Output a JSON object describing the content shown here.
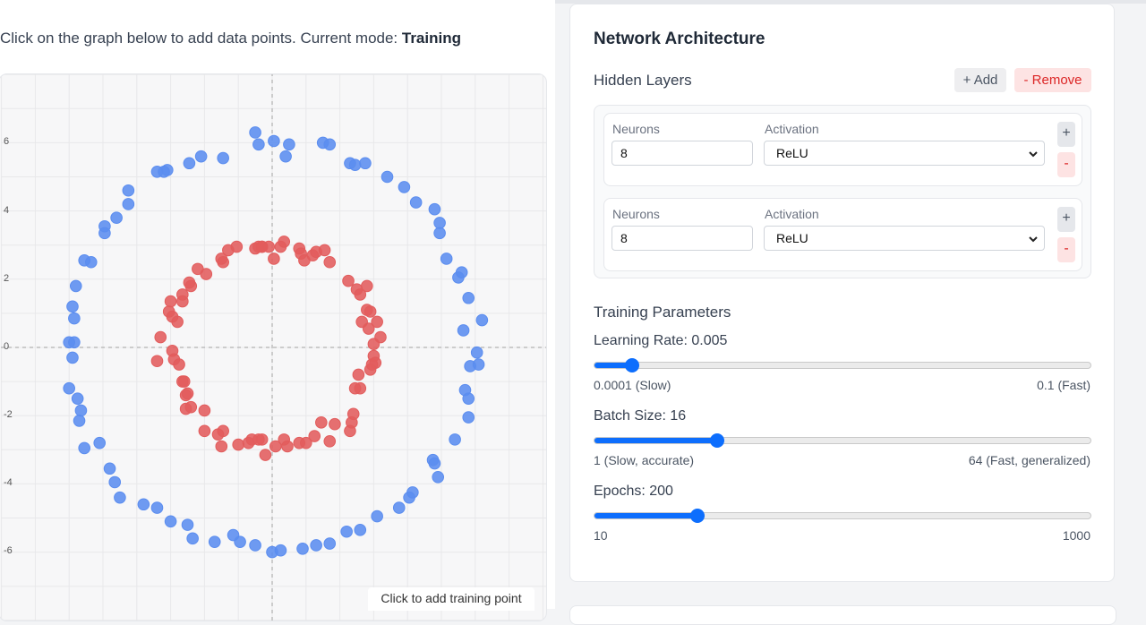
{
  "instruction": {
    "prefix": "Click on the graph below to add data points. Current mode: ",
    "mode": "Training"
  },
  "plot": {
    "hint": "Click to add training point",
    "yticks": [
      "6",
      "4",
      "2",
      "0",
      "-2",
      "-4",
      "-6"
    ],
    "colors": {
      "class_outer": "#5b8def",
      "class_inner": "#e25c5c"
    },
    "blue_points": [
      [
        -0.5,
        6.3
      ],
      [
        -0.4,
        5.95
      ],
      [
        0.05,
        6.05
      ],
      [
        0.5,
        5.95
      ],
      [
        1.5,
        6.0
      ],
      [
        1.7,
        5.95
      ],
      [
        0.4,
        5.6
      ],
      [
        2.3,
        5.4
      ],
      [
        2.45,
        5.35
      ],
      [
        2.75,
        5.4
      ],
      [
        -2.1,
        5.6
      ],
      [
        -1.45,
        5.55
      ],
      [
        -2.45,
        5.4
      ],
      [
        -3.1,
        5.2
      ],
      [
        -3.2,
        5.15
      ],
      [
        -3.4,
        5.15
      ],
      [
        3.4,
        5.0
      ],
      [
        3.9,
        4.7
      ],
      [
        4.25,
        4.25
      ],
      [
        4.8,
        4.05
      ],
      [
        4.95,
        3.65
      ],
      [
        4.95,
        3.35
      ],
      [
        5.15,
        2.6
      ],
      [
        5.6,
        2.2
      ],
      [
        5.5,
        2.05
      ],
      [
        -4.25,
        4.6
      ],
      [
        -4.25,
        4.2
      ],
      [
        -4.6,
        3.8
      ],
      [
        -4.95,
        3.55
      ],
      [
        -4.95,
        3.35
      ],
      [
        -5.35,
        2.5
      ],
      [
        -5.55,
        2.55
      ],
      [
        -5.8,
        1.8
      ],
      [
        5.8,
        1.45
      ],
      [
        6.2,
        0.8
      ],
      [
        5.65,
        0.5
      ],
      [
        -5.9,
        1.2
      ],
      [
        -5.85,
        0.85
      ],
      [
        -6.0,
        0.15
      ],
      [
        -5.85,
        0.15
      ],
      [
        -5.9,
        -0.3
      ],
      [
        6.05,
        -0.15
      ],
      [
        6.1,
        -0.5
      ],
      [
        5.85,
        -0.55
      ],
      [
        -6.0,
        -1.2
      ],
      [
        -5.75,
        -1.5
      ],
      [
        -5.65,
        -1.85
      ],
      [
        -5.7,
        -2.15
      ],
      [
        5.7,
        -1.25
      ],
      [
        5.8,
        -1.5
      ],
      [
        5.8,
        -2.05
      ],
      [
        5.4,
        -2.7
      ],
      [
        -5.1,
        -2.8
      ],
      [
        -5.55,
        -2.95
      ],
      [
        4.75,
        -3.3
      ],
      [
        4.8,
        -3.4
      ],
      [
        4.9,
        -3.8
      ],
      [
        -4.8,
        -3.55
      ],
      [
        -4.65,
        -3.95
      ],
      [
        -4.5,
        -4.4
      ],
      [
        4.15,
        -4.25
      ],
      [
        4.05,
        -4.4
      ],
      [
        3.75,
        -4.7
      ],
      [
        -3.8,
        -4.6
      ],
      [
        -3.4,
        -4.7
      ],
      [
        3.1,
        -4.95
      ],
      [
        2.6,
        -5.35
      ],
      [
        2.2,
        -5.4
      ],
      [
        -3.0,
        -5.1
      ],
      [
        -2.5,
        -5.2
      ],
      [
        -2.35,
        -5.6
      ],
      [
        -1.7,
        -5.7
      ],
      [
        -1.15,
        -5.5
      ],
      [
        -0.95,
        -5.7
      ],
      [
        -0.5,
        -5.8
      ],
      [
        0.0,
        -6.0
      ],
      [
        0.25,
        -5.95
      ],
      [
        0.9,
        -5.9
      ],
      [
        1.3,
        -5.8
      ],
      [
        1.7,
        -5.75
      ]
    ],
    "red_points": [
      [
        -0.5,
        2.9
      ],
      [
        -0.3,
        2.95
      ],
      [
        -0.4,
        2.95
      ],
      [
        -0.3,
        2.95
      ],
      [
        -0.1,
        2.95
      ],
      [
        0.05,
        2.6
      ],
      [
        0.25,
        2.95
      ],
      [
        0.35,
        3.1
      ],
      [
        0.8,
        2.9
      ],
      [
        0.85,
        2.75
      ],
      [
        0.95,
        2.55
      ],
      [
        1.2,
        2.7
      ],
      [
        1.3,
        2.8
      ],
      [
        1.55,
        2.85
      ],
      [
        1.7,
        2.5
      ],
      [
        -1.05,
        2.95
      ],
      [
        -1.3,
        2.85
      ],
      [
        -1.45,
        2.5
      ],
      [
        -1.5,
        2.6
      ],
      [
        -1.95,
        2.15
      ],
      [
        -2.2,
        2.3
      ],
      [
        2.25,
        1.95
      ],
      [
        2.5,
        1.7
      ],
      [
        2.6,
        1.55
      ],
      [
        2.8,
        1.8
      ],
      [
        -2.4,
        1.8
      ],
      [
        -2.45,
        1.9
      ],
      [
        -2.65,
        1.55
      ],
      [
        -2.65,
        1.35
      ],
      [
        -3.0,
        1.35
      ],
      [
        -3.05,
        1.05
      ],
      [
        -2.95,
        0.9
      ],
      [
        -2.8,
        0.75
      ],
      [
        2.8,
        1.1
      ],
      [
        2.9,
        1.05
      ],
      [
        2.65,
        0.75
      ],
      [
        2.85,
        0.55
      ],
      [
        3.1,
        0.75
      ],
      [
        3.2,
        0.3
      ],
      [
        3.0,
        0.1
      ],
      [
        -3.3,
        0.3
      ],
      [
        -2.95,
        -0.1
      ],
      [
        -2.9,
        -0.35
      ],
      [
        -2.75,
        -0.5
      ],
      [
        -3.4,
        -0.4
      ],
      [
        3.0,
        -0.25
      ],
      [
        2.95,
        -0.5
      ],
      [
        3.05,
        -0.45
      ],
      [
        2.9,
        -0.65
      ],
      [
        2.55,
        -0.8
      ],
      [
        -2.65,
        -1.0
      ],
      [
        -2.6,
        -1.0
      ],
      [
        -2.55,
        -1.4
      ],
      [
        -2.5,
        -1.35
      ],
      [
        2.6,
        -1.2
      ],
      [
        2.45,
        -1.2
      ],
      [
        -2.55,
        -1.8
      ],
      [
        -2.4,
        -1.75
      ],
      [
        -2.0,
        -1.85
      ],
      [
        2.4,
        -1.95
      ],
      [
        2.35,
        -2.2
      ],
      [
        2.3,
        -2.45
      ],
      [
        1.45,
        -2.2
      ],
      [
        1.85,
        -2.25
      ],
      [
        -1.45,
        -2.45
      ],
      [
        -1.6,
        -2.55
      ],
      [
        -2.0,
        -2.45
      ],
      [
        -1.5,
        -2.9
      ],
      [
        -1.0,
        -2.85
      ],
      [
        -0.6,
        -2.7
      ],
      [
        -0.7,
        -2.8
      ],
      [
        -0.4,
        -2.7
      ],
      [
        -0.3,
        -2.7
      ],
      [
        -0.2,
        -3.15
      ],
      [
        0.1,
        -2.9
      ],
      [
        0.35,
        -2.7
      ],
      [
        0.45,
        -2.9
      ],
      [
        0.8,
        -2.8
      ],
      [
        1.0,
        -2.8
      ],
      [
        1.25,
        -2.6
      ],
      [
        1.7,
        -2.75
      ]
    ]
  },
  "architecture": {
    "title": "Network Architecture",
    "hidden_layers_label": "Hidden Layers",
    "add_label": "+ Add",
    "remove_label": "- Remove",
    "neurons_label": "Neurons",
    "activation_label": "Activation",
    "layers": [
      {
        "neurons": "8",
        "activation": "ReLU"
      },
      {
        "neurons": "8",
        "activation": "ReLU"
      }
    ],
    "plus": "+",
    "minus": "-"
  },
  "training": {
    "title": "Training Parameters",
    "learning_rate": {
      "label": "Learning Rate: 0.005",
      "min_label": "0.0001 (Slow)",
      "max_label": "0.1 (Fast)",
      "fraction": 0.065
    },
    "batch_size": {
      "label": "Batch Size: 16",
      "min_label": "1 (Slow, accurate)",
      "max_label": "64 (Fast, generalized)",
      "fraction": 0.24
    },
    "epochs": {
      "label": "Epochs: 200",
      "min_label": "10",
      "max_label": "1000",
      "fraction": 0.2
    }
  }
}
